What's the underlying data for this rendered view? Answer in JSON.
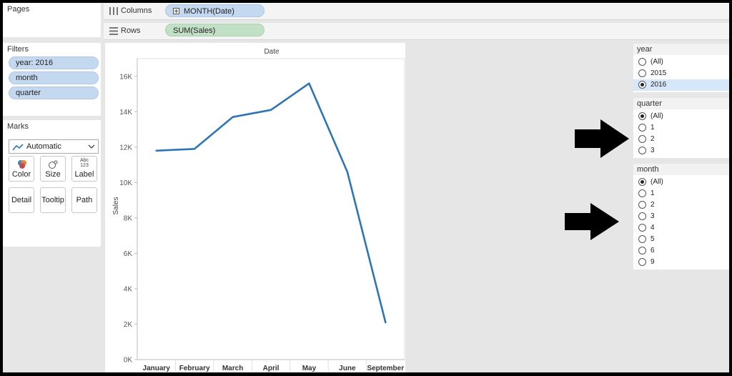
{
  "left_panel": {
    "pages_title": "Pages",
    "filters_title": "Filters",
    "filters": [
      "year: 2016",
      "month",
      "quarter"
    ],
    "marks_title": "Marks",
    "mark_type": "Automatic",
    "mark_buttons": {
      "color": "Color",
      "size": "Size",
      "label": "Label",
      "label_icon": "Abc\n123",
      "detail": "Detail",
      "tooltip": "Tooltip",
      "path": "Path"
    }
  },
  "shelves": {
    "columns_label": "Columns",
    "columns_pill": "MONTH(Date)",
    "rows_label": "Rows",
    "rows_pill": "SUM(Sales)"
  },
  "quick_filters": {
    "year": {
      "title": "year",
      "options": [
        "(All)",
        "2015",
        "2016"
      ],
      "selected": "2016"
    },
    "quarter": {
      "title": "quarter",
      "options": [
        "(All)",
        "1",
        "2",
        "3"
      ],
      "selected": "(All)"
    },
    "month": {
      "title": "month",
      "options": [
        "(All)",
        "1",
        "2",
        "3",
        "4",
        "5",
        "6",
        "9"
      ],
      "selected": "(All)"
    }
  },
  "colors": {
    "line": "#2e75b6",
    "columns_pill": "#c4d8f0",
    "rows_pill": "#c2e0c6",
    "filter_selected_row": "#d6e7fa",
    "arrow": "#000000"
  },
  "icons": {
    "columns_shelf": "columns-icon",
    "rows_shelf": "rows-icon",
    "mark_type": "line-mark-icon",
    "dropdown": "chevron-down-icon",
    "color": "color-circles-icon",
    "size": "size-circles-icon",
    "label": "abc-123-icon",
    "arrows": "black-arrow-right-icon"
  },
  "chart_data": {
    "type": "line",
    "title": "Date",
    "xlabel": "",
    "ylabel": "Sales",
    "categories": [
      "January",
      "February",
      "March",
      "April",
      "May",
      "June",
      "September"
    ],
    "values": [
      11800,
      11900,
      13700,
      14100,
      15600,
      10600,
      2100
    ],
    "ylim": [
      0,
      17000
    ],
    "yticks": [
      0,
      2000,
      4000,
      6000,
      8000,
      10000,
      12000,
      14000,
      16000
    ],
    "ytick_labels": [
      "0K",
      "2K",
      "4K",
      "6K",
      "8K",
      "10K",
      "12K",
      "14K",
      "16K"
    ],
    "grid": false,
    "legend": "none"
  }
}
